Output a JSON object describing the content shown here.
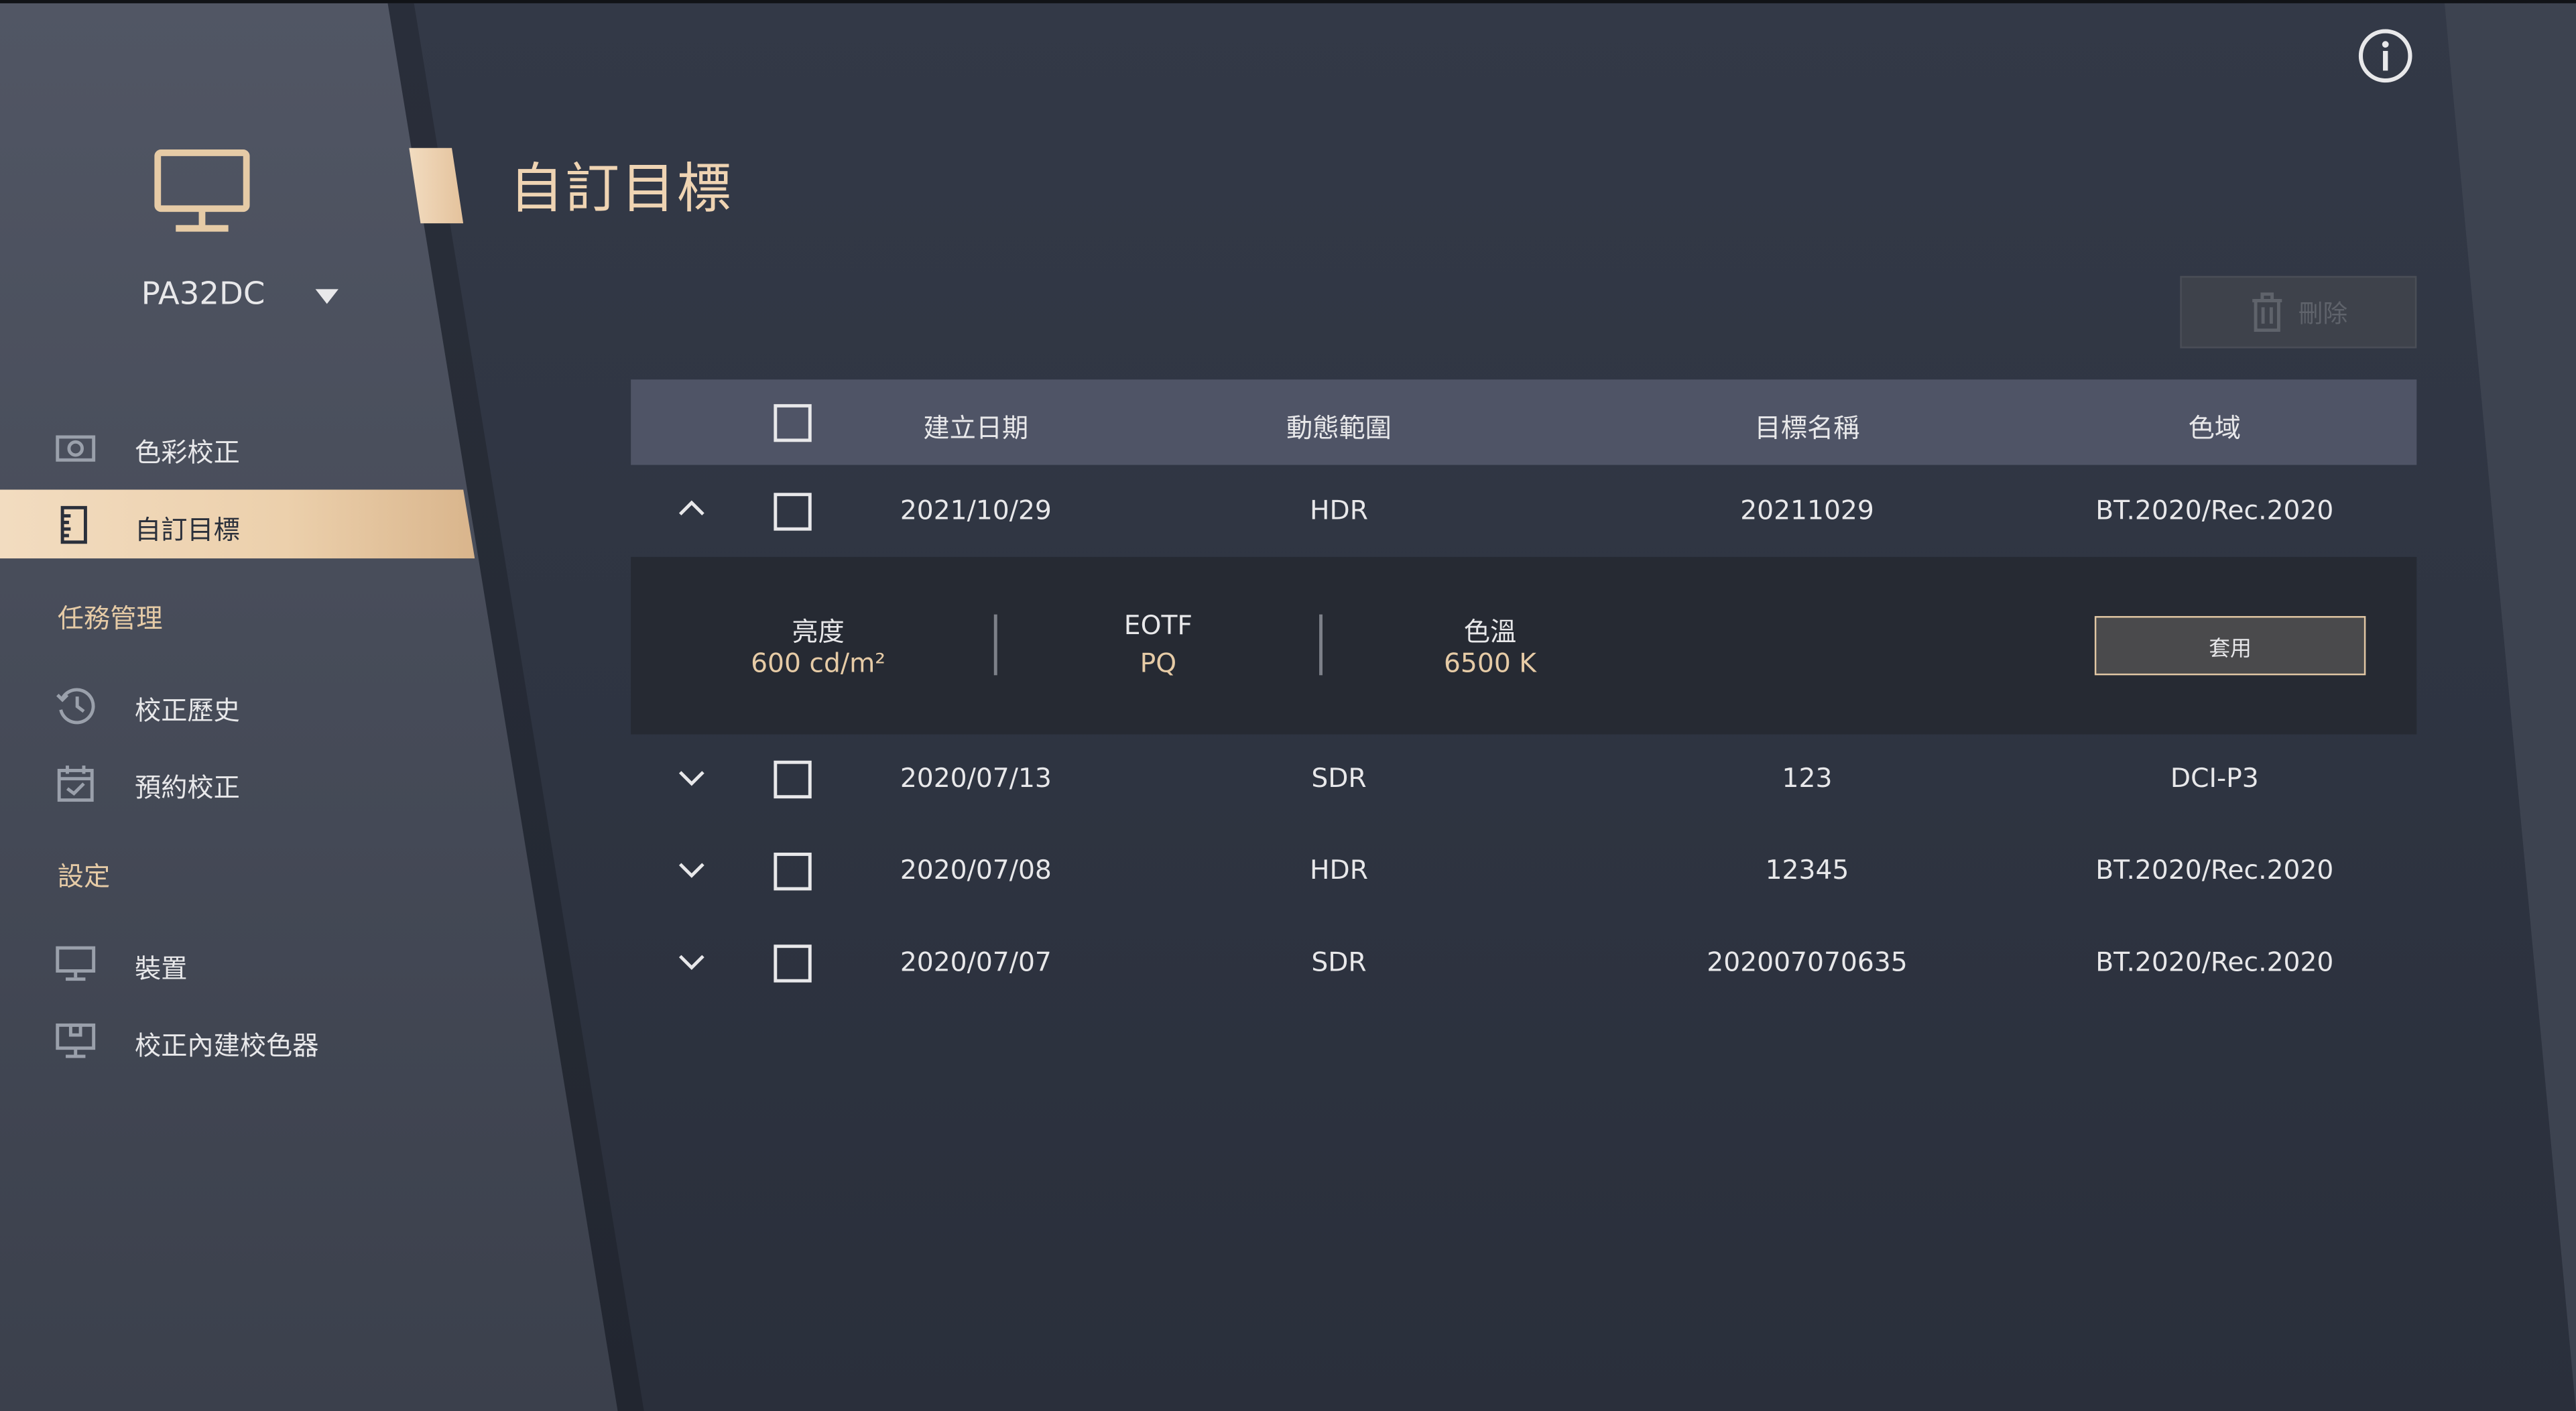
{
  "sidebar": {
    "device": "PA32DC",
    "items": [
      {
        "label": "色彩校正",
        "icon": "camera-icon"
      },
      {
        "label": "自訂目標",
        "icon": "ruler-doc-icon"
      },
      {
        "label": "校正歷史",
        "icon": "history-icon"
      },
      {
        "label": "預約校正",
        "icon": "calendar-check-icon"
      },
      {
        "label": "裝置",
        "icon": "monitor-icon"
      },
      {
        "label": "校正內建校色器",
        "icon": "monitor-calibrator-icon"
      }
    ],
    "sections": {
      "task": "任務管理",
      "settings": "設定"
    }
  },
  "header": {
    "title": "自訂目標",
    "delete_label": "刪除"
  },
  "table": {
    "columns": [
      "建立日期",
      "動態範圍",
      "目標名稱",
      "色域"
    ],
    "rows": [
      {
        "date": "2021/10/29",
        "range": "HDR",
        "name": "20211029",
        "gamut": "BT.2020/Rec.2020",
        "expanded": true
      },
      {
        "date": "2020/07/13",
        "range": "SDR",
        "name": "123",
        "gamut": "DCI-P3",
        "expanded": false
      },
      {
        "date": "2020/07/08",
        "range": "HDR",
        "name": "12345",
        "gamut": "BT.2020/Rec.2020",
        "expanded": false
      },
      {
        "date": "2020/07/07",
        "range": "SDR",
        "name": "202007070635",
        "gamut": "BT.2020/Rec.2020",
        "expanded": false
      }
    ],
    "detail": {
      "brightness_label": "亮度",
      "brightness_value": "600 cd/m²",
      "eotf_label": "EOTF",
      "eotf_value": "PQ",
      "temp_label": "色溫",
      "temp_value": "6500 K",
      "apply_label": "套用"
    }
  },
  "colors": {
    "accent": "#e6cba6",
    "background": "#2b303b",
    "sidebar": "#4b505d",
    "table_header": "#4f5466"
  }
}
